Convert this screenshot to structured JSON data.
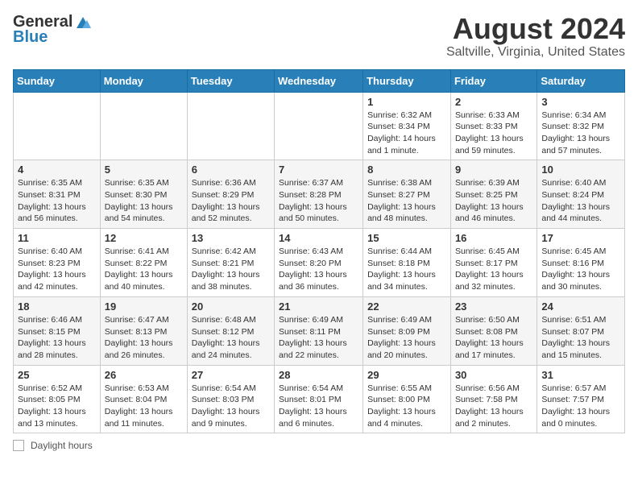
{
  "header": {
    "logo_general": "General",
    "logo_blue": "Blue",
    "month": "August 2024",
    "location": "Saltville, Virginia, United States"
  },
  "days_of_week": [
    "Sunday",
    "Monday",
    "Tuesday",
    "Wednesday",
    "Thursday",
    "Friday",
    "Saturday"
  ],
  "weeks": [
    [
      {
        "day": "",
        "info": ""
      },
      {
        "day": "",
        "info": ""
      },
      {
        "day": "",
        "info": ""
      },
      {
        "day": "",
        "info": ""
      },
      {
        "day": "1",
        "info": "Sunrise: 6:32 AM\nSunset: 8:34 PM\nDaylight: 14 hours and 1 minute."
      },
      {
        "day": "2",
        "info": "Sunrise: 6:33 AM\nSunset: 8:33 PM\nDaylight: 13 hours and 59 minutes."
      },
      {
        "day": "3",
        "info": "Sunrise: 6:34 AM\nSunset: 8:32 PM\nDaylight: 13 hours and 57 minutes."
      }
    ],
    [
      {
        "day": "4",
        "info": "Sunrise: 6:35 AM\nSunset: 8:31 PM\nDaylight: 13 hours and 56 minutes."
      },
      {
        "day": "5",
        "info": "Sunrise: 6:35 AM\nSunset: 8:30 PM\nDaylight: 13 hours and 54 minutes."
      },
      {
        "day": "6",
        "info": "Sunrise: 6:36 AM\nSunset: 8:29 PM\nDaylight: 13 hours and 52 minutes."
      },
      {
        "day": "7",
        "info": "Sunrise: 6:37 AM\nSunset: 8:28 PM\nDaylight: 13 hours and 50 minutes."
      },
      {
        "day": "8",
        "info": "Sunrise: 6:38 AM\nSunset: 8:27 PM\nDaylight: 13 hours and 48 minutes."
      },
      {
        "day": "9",
        "info": "Sunrise: 6:39 AM\nSunset: 8:25 PM\nDaylight: 13 hours and 46 minutes."
      },
      {
        "day": "10",
        "info": "Sunrise: 6:40 AM\nSunset: 8:24 PM\nDaylight: 13 hours and 44 minutes."
      }
    ],
    [
      {
        "day": "11",
        "info": "Sunrise: 6:40 AM\nSunset: 8:23 PM\nDaylight: 13 hours and 42 minutes."
      },
      {
        "day": "12",
        "info": "Sunrise: 6:41 AM\nSunset: 8:22 PM\nDaylight: 13 hours and 40 minutes."
      },
      {
        "day": "13",
        "info": "Sunrise: 6:42 AM\nSunset: 8:21 PM\nDaylight: 13 hours and 38 minutes."
      },
      {
        "day": "14",
        "info": "Sunrise: 6:43 AM\nSunset: 8:20 PM\nDaylight: 13 hours and 36 minutes."
      },
      {
        "day": "15",
        "info": "Sunrise: 6:44 AM\nSunset: 8:18 PM\nDaylight: 13 hours and 34 minutes."
      },
      {
        "day": "16",
        "info": "Sunrise: 6:45 AM\nSunset: 8:17 PM\nDaylight: 13 hours and 32 minutes."
      },
      {
        "day": "17",
        "info": "Sunrise: 6:45 AM\nSunset: 8:16 PM\nDaylight: 13 hours and 30 minutes."
      }
    ],
    [
      {
        "day": "18",
        "info": "Sunrise: 6:46 AM\nSunset: 8:15 PM\nDaylight: 13 hours and 28 minutes."
      },
      {
        "day": "19",
        "info": "Sunrise: 6:47 AM\nSunset: 8:13 PM\nDaylight: 13 hours and 26 minutes."
      },
      {
        "day": "20",
        "info": "Sunrise: 6:48 AM\nSunset: 8:12 PM\nDaylight: 13 hours and 24 minutes."
      },
      {
        "day": "21",
        "info": "Sunrise: 6:49 AM\nSunset: 8:11 PM\nDaylight: 13 hours and 22 minutes."
      },
      {
        "day": "22",
        "info": "Sunrise: 6:49 AM\nSunset: 8:09 PM\nDaylight: 13 hours and 20 minutes."
      },
      {
        "day": "23",
        "info": "Sunrise: 6:50 AM\nSunset: 8:08 PM\nDaylight: 13 hours and 17 minutes."
      },
      {
        "day": "24",
        "info": "Sunrise: 6:51 AM\nSunset: 8:07 PM\nDaylight: 13 hours and 15 minutes."
      }
    ],
    [
      {
        "day": "25",
        "info": "Sunrise: 6:52 AM\nSunset: 8:05 PM\nDaylight: 13 hours and 13 minutes."
      },
      {
        "day": "26",
        "info": "Sunrise: 6:53 AM\nSunset: 8:04 PM\nDaylight: 13 hours and 11 minutes."
      },
      {
        "day": "27",
        "info": "Sunrise: 6:54 AM\nSunset: 8:03 PM\nDaylight: 13 hours and 9 minutes."
      },
      {
        "day": "28",
        "info": "Sunrise: 6:54 AM\nSunset: 8:01 PM\nDaylight: 13 hours and 6 minutes."
      },
      {
        "day": "29",
        "info": "Sunrise: 6:55 AM\nSunset: 8:00 PM\nDaylight: 13 hours and 4 minutes."
      },
      {
        "day": "30",
        "info": "Sunrise: 6:56 AM\nSunset: 7:58 PM\nDaylight: 13 hours and 2 minutes."
      },
      {
        "day": "31",
        "info": "Sunrise: 6:57 AM\nSunset: 7:57 PM\nDaylight: 13 hours and 0 minutes."
      }
    ]
  ],
  "footer": {
    "legend_label": "Daylight hours"
  }
}
